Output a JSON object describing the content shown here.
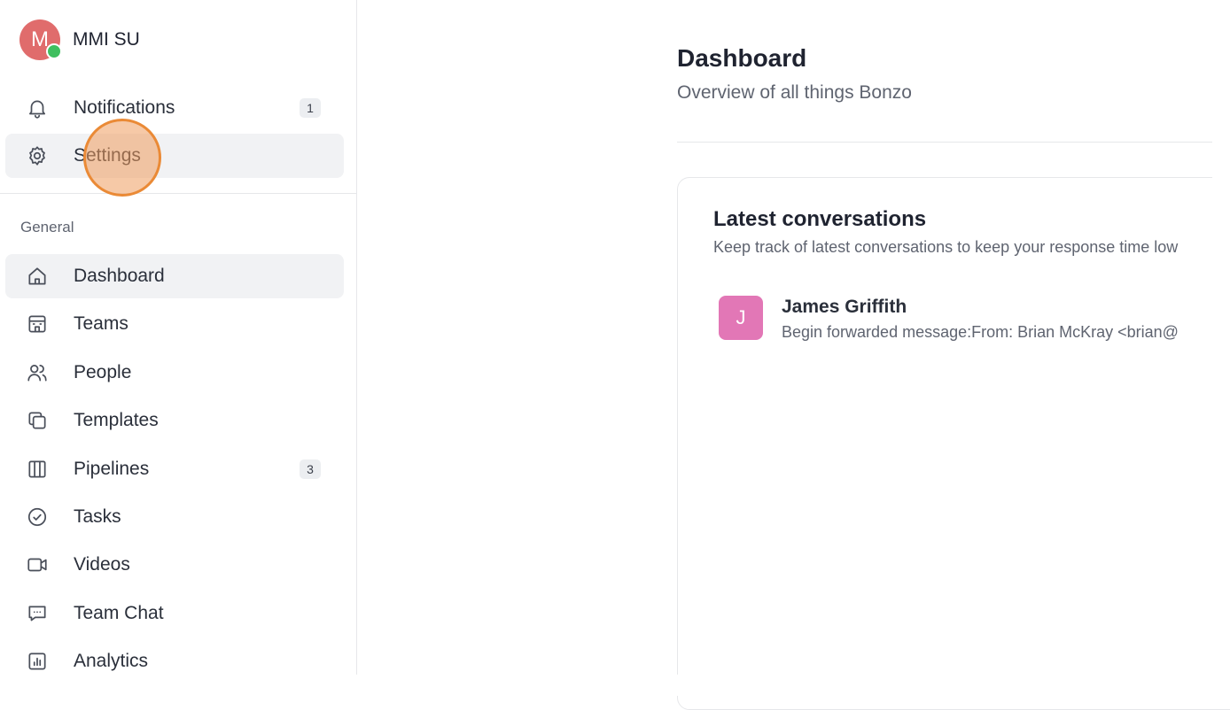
{
  "user": {
    "initial": "M",
    "name": "MMI SU"
  },
  "top_nav": [
    {
      "label": "Notifications",
      "icon": "bell-icon",
      "badge": "1",
      "active": false
    },
    {
      "label": "Settings",
      "icon": "gear-icon",
      "active": true
    }
  ],
  "section_general": "General",
  "general_nav": [
    {
      "label": "Dashboard",
      "icon": "home-icon",
      "active": true
    },
    {
      "label": "Teams",
      "icon": "building-icon"
    },
    {
      "label": "People",
      "icon": "users-icon"
    },
    {
      "label": "Templates",
      "icon": "copy-icon"
    },
    {
      "label": "Pipelines",
      "icon": "columns-icon",
      "badge": "3"
    },
    {
      "label": "Tasks",
      "icon": "check-circle-icon"
    },
    {
      "label": "Videos",
      "icon": "video-icon"
    },
    {
      "label": "Team Chat",
      "icon": "chat-icon"
    },
    {
      "label": "Analytics",
      "icon": "chart-icon"
    }
  ],
  "main": {
    "title": "Dashboard",
    "subtitle": "Overview of all things Bonzo",
    "card": {
      "title": "Latest conversations",
      "subtitle": "Keep track of latest conversations to keep your response time low",
      "conversations": [
        {
          "initial": "J",
          "name": "James Griffith",
          "preview": "Begin forwarded message:From: Brian McKray <brian@"
        }
      ]
    }
  },
  "colors": {
    "avatar_user": "#e06c6c",
    "online": "#3fbf5f",
    "avatar_conversation": "#e277b6",
    "click_highlight": "#ea8a36"
  }
}
